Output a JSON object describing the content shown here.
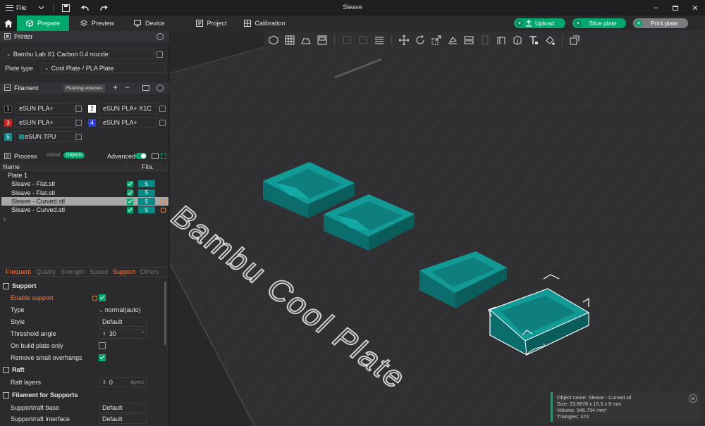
{
  "app": {
    "title": "Sleave"
  },
  "menu": {
    "file_label": "File"
  },
  "tabs": [
    {
      "label": "Prepare",
      "icon": "cube-icon",
      "active": true
    },
    {
      "label": "Preview",
      "icon": "layers-icon"
    },
    {
      "label": "Device",
      "icon": "monitor-icon"
    },
    {
      "label": "Project",
      "icon": "document-icon"
    },
    {
      "label": "Calibration",
      "icon": "calibration-icon"
    }
  ],
  "actions": {
    "upload": "Upload",
    "slice": "Slice plate",
    "print": "Print plate"
  },
  "printer": {
    "section_label": "Printer",
    "name": "Bambu Lab X1 Carbon 0.4 nozzle",
    "plate_type_label": "Plate type",
    "plate_type_value": "Cool Plate / PLA Plate"
  },
  "filament": {
    "section_label": "Filament",
    "flushing_label": "Flushing volumes",
    "items": [
      {
        "num": "1",
        "name": "eSUN PLA+",
        "color": "#111111"
      },
      {
        "num": "2",
        "name": "eSUN PLA+ X1C",
        "color": "#ffffff"
      },
      {
        "num": "3",
        "name": "eSUN PLA+",
        "color": "#d21f1f"
      },
      {
        "num": "4",
        "name": "eSUN PLA+",
        "color": "#2a3be0"
      },
      {
        "num": "5",
        "name": "eSUN TPU",
        "color": "#0d8c8a"
      }
    ]
  },
  "process": {
    "section_label": "Process",
    "global_label": "Global",
    "objects_label": "Objects",
    "advanced_label": "Advanced"
  },
  "objects_table": {
    "col_name": "Name",
    "col_fila": "Fila.",
    "plate": "Plate 1",
    "rows": [
      {
        "name": "Sleave - Flat.stl",
        "fila": "5",
        "selected": false,
        "lock": false
      },
      {
        "name": "Sleave - Flat.stl",
        "fila": "5",
        "selected": false,
        "lock": false
      },
      {
        "name": "Sleave - Curved.stl",
        "fila": "5",
        "selected": true,
        "lock": true
      },
      {
        "name": "Sleave - Curved.stl",
        "fila": "5",
        "selected": false,
        "lock": true
      }
    ]
  },
  "settings_tabs": [
    "Frequent",
    "Quality",
    "Strength",
    "Speed",
    "Support",
    "Others"
  ],
  "support": {
    "section_label": "Support",
    "enable_label": "Enable support",
    "type_label": "Type",
    "type_value": "normal(auto)",
    "style_label": "Style",
    "style_value": "Default",
    "threshold_label": "Threshold angle",
    "threshold_value": "30",
    "threshold_unit": "°",
    "build_plate_label": "On build plate only",
    "remove_small_label": "Remove small overhangs"
  },
  "raft": {
    "section_label": "Raft",
    "layers_label": "Raft layers",
    "layers_value": "0",
    "layers_unit": "layers"
  },
  "filament_support": {
    "section_label": "Filament for Supports",
    "base_label": "Support/raft base",
    "base_value": "Default",
    "interface_label": "Support/raft interface",
    "interface_value": "Default"
  },
  "bed_text": "Bambu Cool Plate",
  "object_info": {
    "name": "Object name: Sleave - Curved.stl",
    "size": "Size: 23.8878 x 15.5 x 8 mm",
    "volume": "Volume: 946.794 mm³",
    "triangles": "Triangles: 374"
  },
  "colors": {
    "accent": "#00a86b",
    "orange": "#ff7a3a",
    "teal_model": "#0d8c8a"
  }
}
